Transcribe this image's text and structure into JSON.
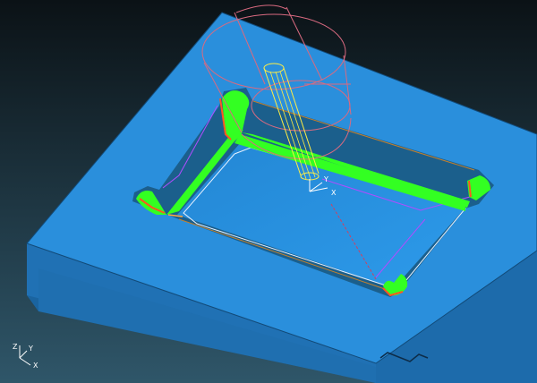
{
  "viewport": {
    "background_top": "#0c1418",
    "background_bottom": "#2e5466",
    "part_top_color": "#2a8fdc",
    "part_side_left_color": "#1b6aa8",
    "part_side_front_color": "#2176bb",
    "pocket_wall_color": "#1a5c86",
    "pocket_floor_color": "#2a94e0",
    "toolpath_color": "#33ff22",
    "toolpath_edge_color": "#ff5522",
    "tool_holder_color": "#e07080",
    "tool_color": "#ffee44",
    "guide_line_color": "#cc44ff"
  },
  "scene": {
    "part_block": "part-block",
    "pocket": "rectangular-pocket",
    "toolpath": "pocket-toolpath",
    "tool": "end-mill-tool",
    "holder": "tool-holder"
  },
  "triad": {
    "z_label": "Z",
    "y_label": "Y",
    "x_label": "X"
  },
  "tool_axes": {
    "y_label": "Y",
    "x_label": "X"
  }
}
